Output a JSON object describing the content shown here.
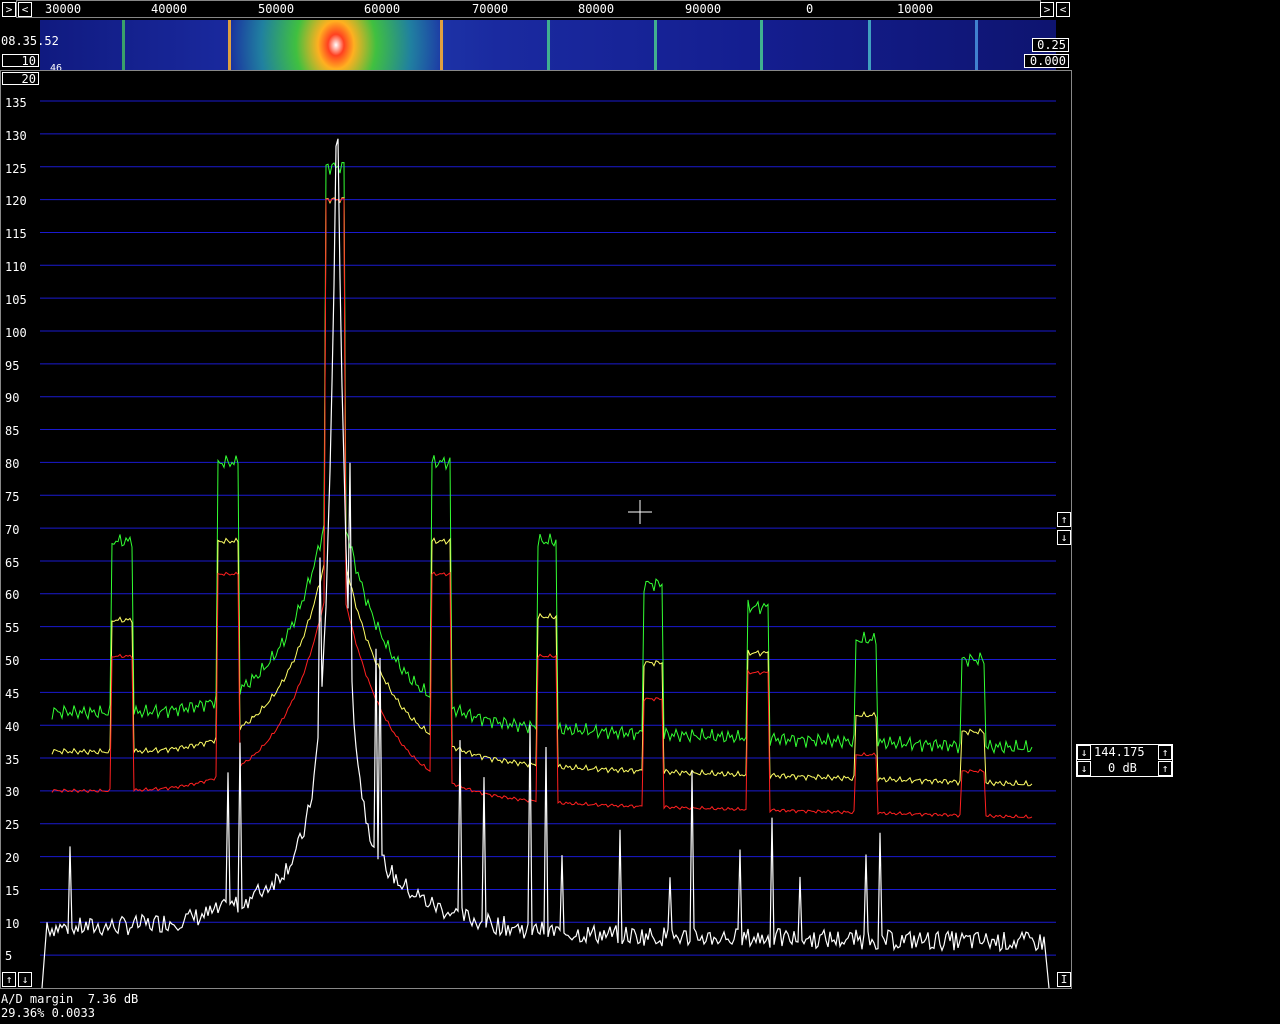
{
  "freq_scale": {
    "labels": [
      "30000",
      "40000",
      "50000",
      "60000",
      "70000",
      "80000",
      "90000",
      "0",
      "10000"
    ]
  },
  "waterfall": {
    "time": "08.35.52",
    "avg_value": "10",
    "small_label": "46",
    "gain_value": "0.25",
    "zero_value": "0.000",
    "avgnum_value": "20"
  },
  "y_axis": {
    "labels": [
      "135",
      "130",
      "125",
      "120",
      "115",
      "110",
      "105",
      "100",
      "95",
      "90",
      "85",
      "80",
      "75",
      "70",
      "65",
      "60",
      "55",
      "50",
      "45",
      "40",
      "35",
      "30",
      "25",
      "20",
      "15",
      "10",
      "5"
    ]
  },
  "side_panel": {
    "frequency": "144.175",
    "level": "0 dB"
  },
  "status": {
    "ad_margin": "A/D margin  7.36 dB",
    "load": "29.36% 0.0033"
  },
  "colors": {
    "grid": "#1a1ad0",
    "green": "#33ff33",
    "yellow": "#ffff66",
    "red": "#ff2020",
    "white": "#ffffff"
  }
}
